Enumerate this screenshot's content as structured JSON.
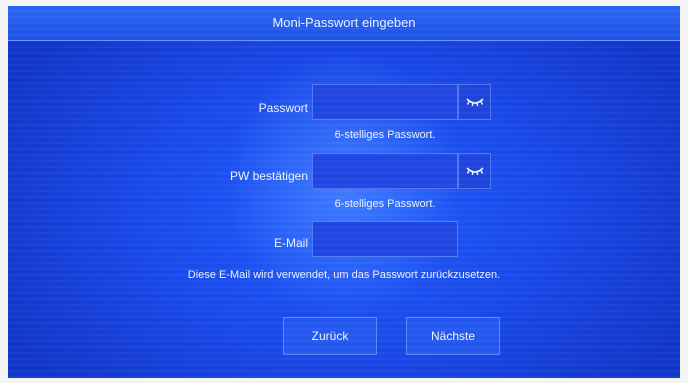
{
  "header": {
    "title": "Moni-Passwort eingeben"
  },
  "form": {
    "password": {
      "label": "Passwort",
      "value": "",
      "hint": "6-stelliges Passwort."
    },
    "confirm": {
      "label": "PW bestätigen",
      "value": "",
      "hint": "6-stelliges Passwort."
    },
    "email": {
      "label": "E-Mail",
      "value": "",
      "hint": "Diese E-Mail wird verwendet, um das Passwort zurückzusetzen."
    }
  },
  "buttons": {
    "back": "Zurück",
    "next": "Nächste"
  },
  "icons": {
    "password_toggle": "eye-closed-icon",
    "confirm_toggle": "eye-closed-icon"
  },
  "colors": {
    "background": "#1a49e8",
    "text": "#eef3ff"
  }
}
